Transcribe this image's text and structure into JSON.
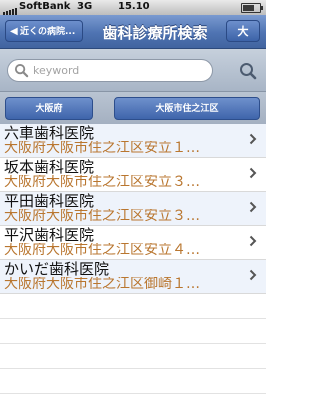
{
  "status": {
    "carrier": "SoftBank",
    "network": "3G",
    "time": "15.10",
    "battery_level": 0.7
  },
  "nav": {
    "back_label": "近くの病院...",
    "title": "歯科診療所検索",
    "right_label": "大"
  },
  "search": {
    "placeholder": "keyword"
  },
  "filters": {
    "prefecture": "大阪府",
    "ward": "大阪市住之江区"
  },
  "results": [
    {
      "name": "六車歯科医院",
      "address": "大阪府大阪市住之江区安立１…"
    },
    {
      "name": "坂本歯科医院",
      "address": "大阪府大阪市住之江区安立３…"
    },
    {
      "name": "平田歯科医院",
      "address": "大阪府大阪市住之江区安立３…"
    },
    {
      "name": "平沢歯科医院",
      "address": "大阪府大阪市住之江区安立４…"
    },
    {
      "name": "かいだ歯科医院",
      "address": "大阪府大阪市住之江区御崎１…"
    }
  ]
}
